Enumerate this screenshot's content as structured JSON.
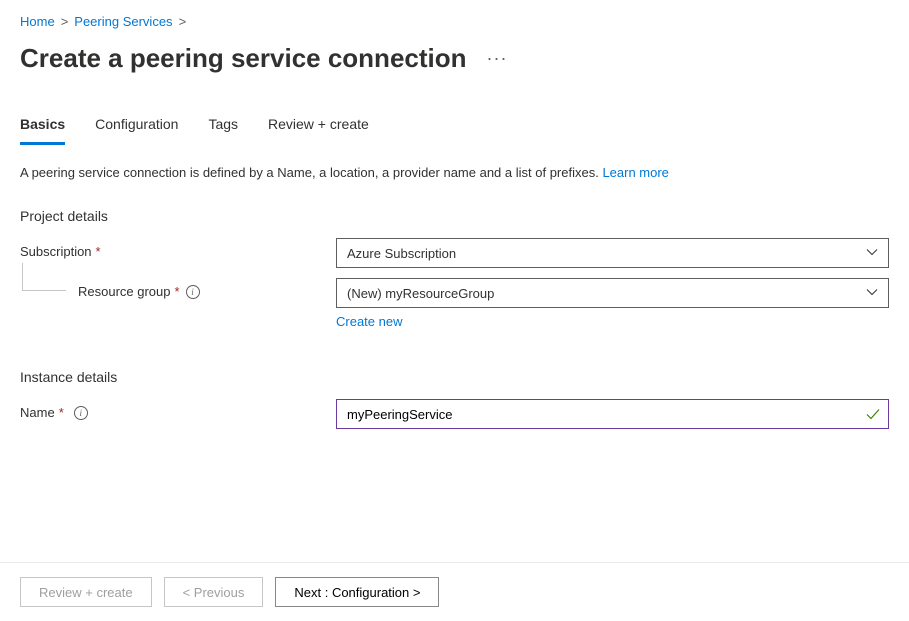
{
  "breadcrumb": {
    "items": [
      "Home",
      "Peering Services"
    ],
    "sep": ">"
  },
  "page": {
    "title": "Create a peering service connection",
    "more": "···"
  },
  "tabs": [
    {
      "label": "Basics"
    },
    {
      "label": "Configuration"
    },
    {
      "label": "Tags"
    },
    {
      "label": "Review + create"
    }
  ],
  "description": {
    "text": "A peering service connection is defined by a Name, a location, a provider name and a list of prefixes. ",
    "link": "Learn more"
  },
  "sections": {
    "project": {
      "title": "Project details",
      "subscription": {
        "label": "Subscription",
        "value": "Azure Subscription"
      },
      "resourceGroup": {
        "label": "Resource group",
        "value": "(New) myResourceGroup",
        "createNew": "Create new"
      }
    },
    "instance": {
      "title": "Instance details",
      "name": {
        "label": "Name",
        "value": "myPeeringService"
      }
    }
  },
  "footer": {
    "reviewCreate": "Review + create",
    "previous": "< Previous",
    "next": "Next : Configuration >"
  }
}
